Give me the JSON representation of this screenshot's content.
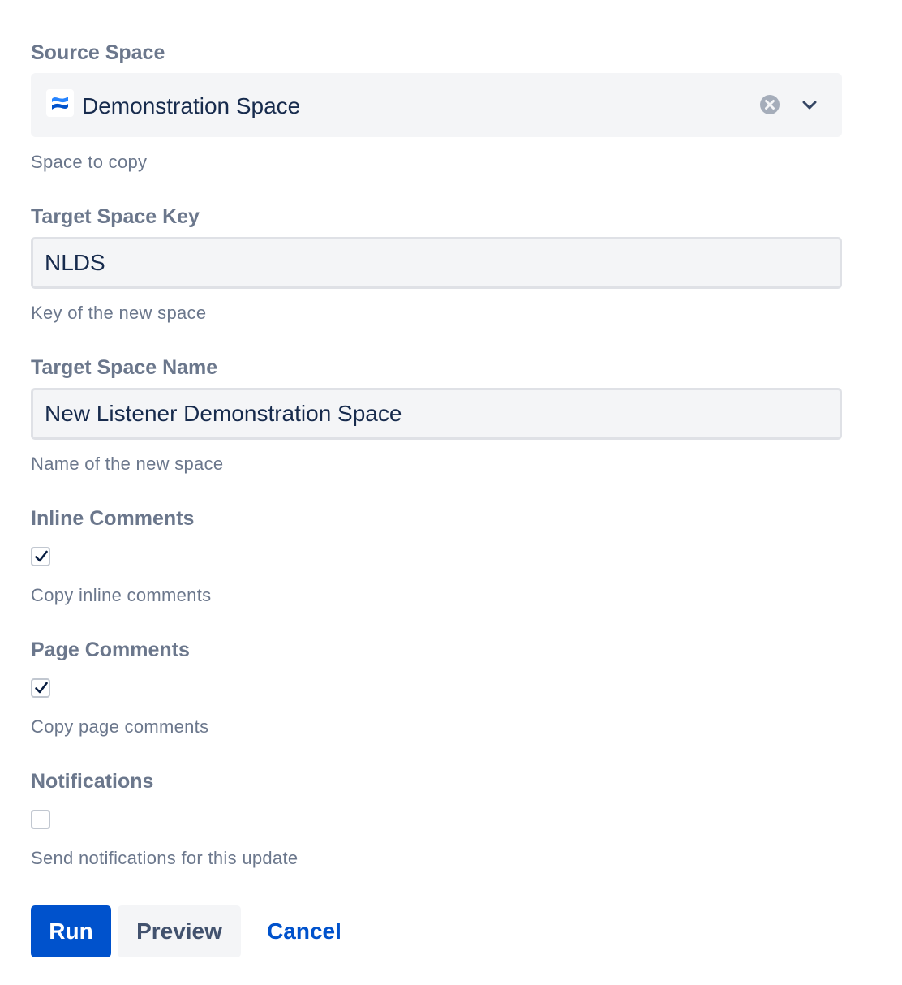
{
  "source_space": {
    "label": "Source Space",
    "value": "Demonstration Space",
    "help": "Space to copy",
    "space_icon": "confluence-logo-icon",
    "clear_icon": "clear-icon",
    "dropdown_icon": "chevron-down-icon"
  },
  "target_space_key": {
    "label": "Target Space Key",
    "value": "NLDS",
    "help": "Key of the new space"
  },
  "target_space_name": {
    "label": "Target Space Name",
    "value": "New Listener Demonstration Space",
    "help": "Name of the new space"
  },
  "inline_comments": {
    "label": "Inline Comments",
    "checked": true,
    "help": "Copy inline comments"
  },
  "page_comments": {
    "label": "Page Comments",
    "checked": true,
    "help": "Copy page comments"
  },
  "notifications": {
    "label": "Notifications",
    "checked": false,
    "help": "Send notifications for this update"
  },
  "actions": {
    "run_label": "Run",
    "preview_label": "Preview",
    "cancel_label": "Cancel"
  },
  "colors": {
    "primary": "#0052cc",
    "label_text": "#6b778c",
    "field_background": "#f4f5f7",
    "field_border": "#dfe1e6",
    "text": "#172b4d"
  }
}
